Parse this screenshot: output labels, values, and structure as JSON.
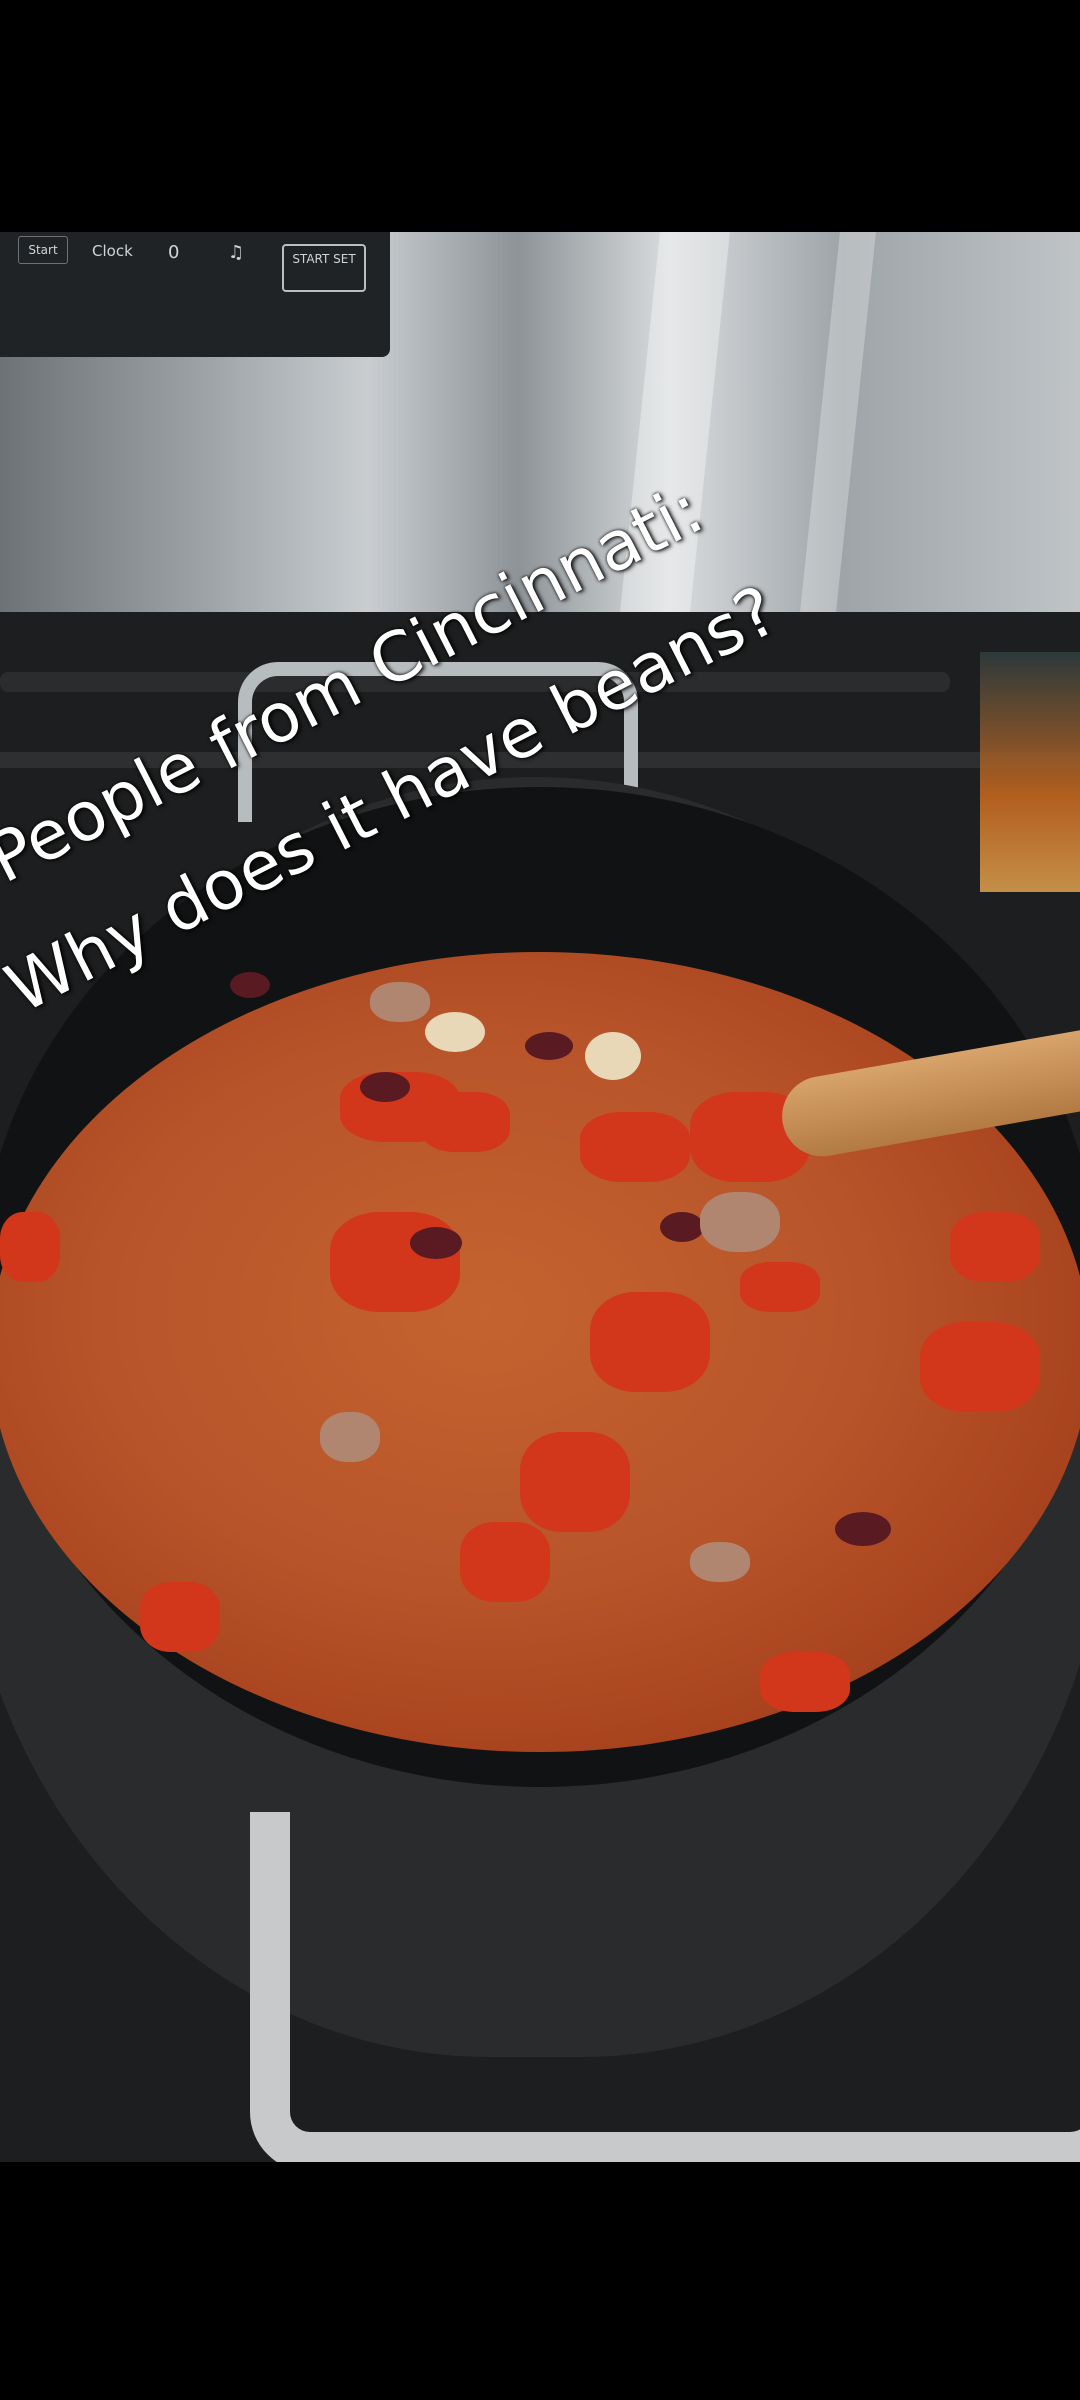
{
  "caption": {
    "line1": "People from Cincinnati:",
    "line2": "Why does it have beans?"
  },
  "stove_controls": {
    "start_label": "Start",
    "clock_label": "Clock",
    "dot_label": "0",
    "bell_label": "♫",
    "start_set_label": "START SET"
  },
  "colors": {
    "background": "#000000",
    "caption_text": "#ffffff",
    "chili_sauce": "#b8542a"
  }
}
